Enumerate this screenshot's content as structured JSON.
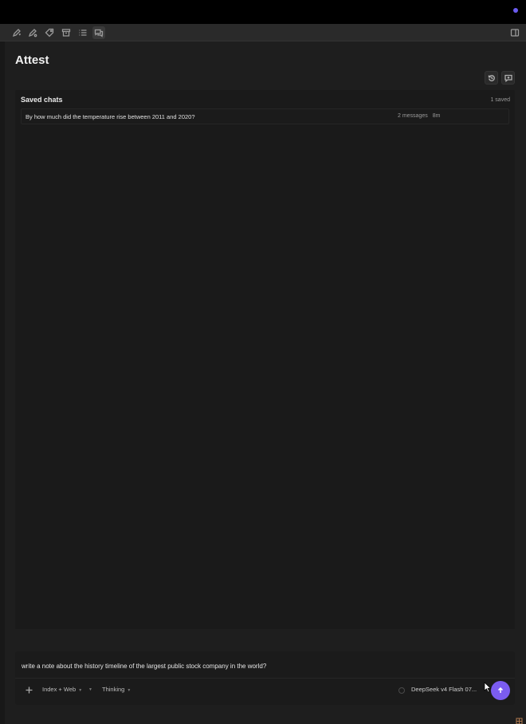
{
  "app": {
    "title": "Attest",
    "accent_color": "#7b5cf0"
  },
  "toolbar": {
    "icons": [
      "pen-sparkle-icon",
      "pen-settings-icon",
      "tag-icon",
      "archive-icon",
      "list-icon",
      "chat-bubbles-icon"
    ],
    "active_index": 5,
    "right_icon": "sidebar-toggle-icon"
  },
  "header_actions": {
    "history_icon": "history-icon",
    "new_chat_icon": "new-chat-icon"
  },
  "saved_chats": {
    "title": "Saved chats",
    "count_label": "1 saved",
    "items": [
      {
        "title": "By how much did the temperature rise between 2011 and 2020?",
        "messages": "2 messages",
        "age": "8m"
      }
    ]
  },
  "composer": {
    "input_value": "write a note about the history timeline of the largest public stock company in the world?",
    "source_selector": "Index + Web",
    "mode_selector": "Thinking",
    "model_selector": "DeepSeek v4 Flash 07...",
    "send_icon": "arrow-up-icon",
    "add_icon": "plus-icon"
  }
}
